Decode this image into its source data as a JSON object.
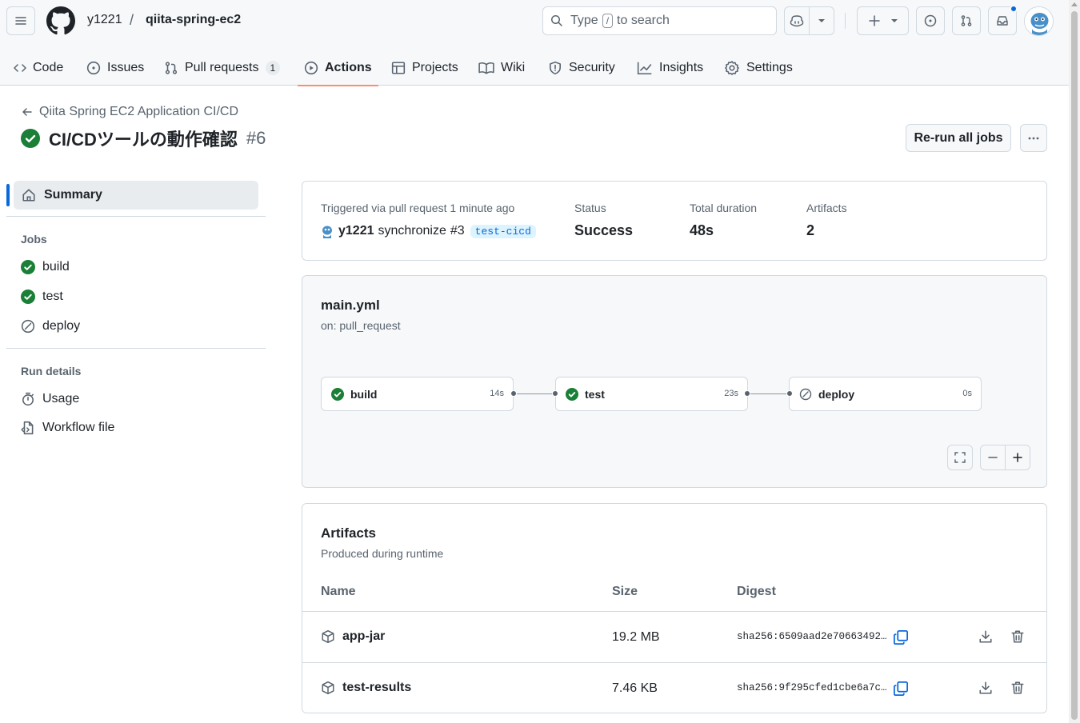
{
  "header": {
    "owner": "y1221",
    "separator": "/",
    "repo": "qiita-spring-ec2",
    "search_prefix": "Type",
    "search_key": "/",
    "search_suffix": "to search"
  },
  "tabs": [
    {
      "label": "Code"
    },
    {
      "label": "Issues"
    },
    {
      "label": "Pull requests",
      "count": "1"
    },
    {
      "label": "Actions"
    },
    {
      "label": "Projects"
    },
    {
      "label": "Wiki"
    },
    {
      "label": "Security"
    },
    {
      "label": "Insights"
    },
    {
      "label": "Settings"
    }
  ],
  "run": {
    "workflow_link": "Qiita Spring EC2 Application CI/CD",
    "title": "CI/CDツールの動作確認",
    "number": "#6",
    "rerun_label": "Re-run all jobs"
  },
  "sidebar": {
    "summary_label": "Summary",
    "jobs_heading": "Jobs",
    "jobs": [
      {
        "label": "build",
        "status": "success"
      },
      {
        "label": "test",
        "status": "success"
      },
      {
        "label": "deploy",
        "status": "skipped"
      }
    ],
    "run_details_heading": "Run details",
    "usage_label": "Usage",
    "workflow_file_label": "Workflow file"
  },
  "summary": {
    "triggered_label": "Triggered via pull request 1 minute ago",
    "actor": "y1221",
    "event_text": "synchronize",
    "pr_ref": "#3",
    "branch": "test-cicd",
    "status_label": "Status",
    "status_value": "Success",
    "duration_label": "Total duration",
    "duration_value": "48s",
    "artifacts_label": "Artifacts",
    "artifacts_value": "2"
  },
  "workflow": {
    "file": "main.yml",
    "trigger": "on: pull_request",
    "jobs": [
      {
        "name": "build",
        "duration": "14s",
        "status": "success"
      },
      {
        "name": "test",
        "duration": "23s",
        "status": "success"
      },
      {
        "name": "deploy",
        "duration": "0s",
        "status": "skipped"
      }
    ]
  },
  "artifacts": {
    "title": "Artifacts",
    "subtitle": "Produced during runtime",
    "columns": {
      "name": "Name",
      "size": "Size",
      "digest": "Digest"
    },
    "rows": [
      {
        "name": "app-jar",
        "size": "19.2 MB",
        "digest": "sha256:6509aad2e70663492…"
      },
      {
        "name": "test-results",
        "size": "7.46 KB",
        "digest": "sha256:9f295cfed1cbe6a7c…"
      }
    ]
  },
  "colors": {
    "success": "#1a7f37",
    "accent": "#0969da",
    "tab_underline": "#fd8c73"
  }
}
